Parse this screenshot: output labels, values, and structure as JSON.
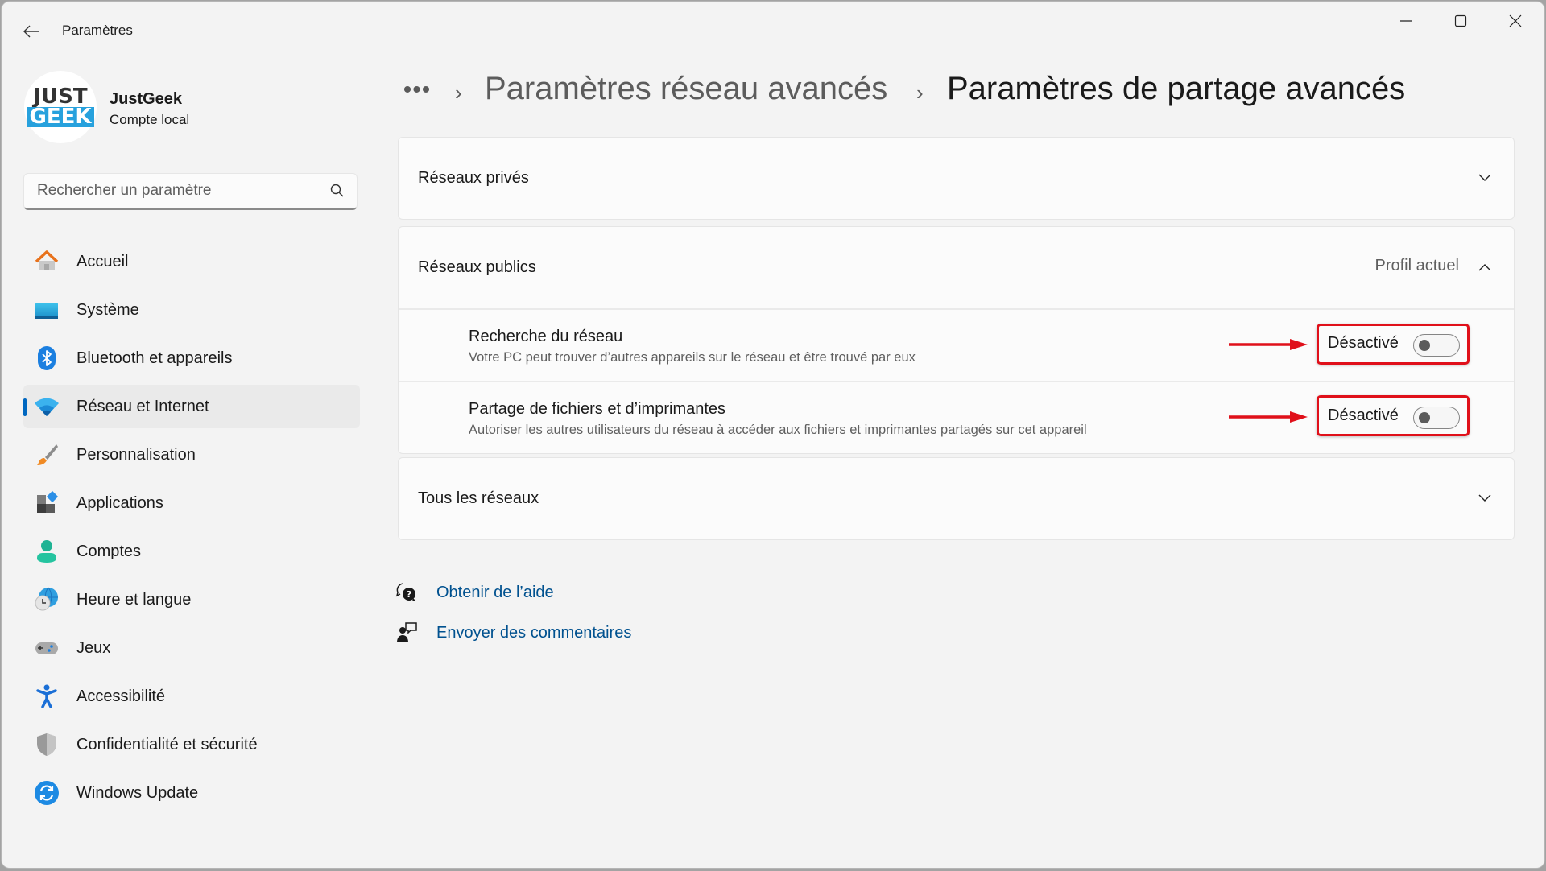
{
  "window": {
    "title": "Paramètres",
    "controls": {
      "minimize": "minimize-icon",
      "maximize": "maximize-icon",
      "close": "close-icon"
    },
    "back_icon": "arrow-left-icon"
  },
  "profile": {
    "avatar_line1": "JUST",
    "avatar_line2": "GEEK",
    "name": "JustGeek",
    "account_type": "Compte local"
  },
  "search": {
    "placeholder": "Rechercher un paramètre",
    "value": "",
    "icon": "search-icon"
  },
  "sidebar": {
    "accent_color": "#0067c0",
    "items": [
      {
        "label": "Accueil",
        "icon": "home-icon",
        "active": false
      },
      {
        "label": "Système",
        "icon": "system-display-icon",
        "active": false
      },
      {
        "label": "Bluetooth et appareils",
        "icon": "bluetooth-icon",
        "active": false
      },
      {
        "label": "Réseau et Internet",
        "icon": "wifi-icon",
        "active": true
      },
      {
        "label": "Personnalisation",
        "icon": "paintbrush-icon",
        "active": false
      },
      {
        "label": "Applications",
        "icon": "apps-icon",
        "active": false
      },
      {
        "label": "Comptes",
        "icon": "account-icon",
        "active": false
      },
      {
        "label": "Heure et langue",
        "icon": "time-language-icon",
        "active": false
      },
      {
        "label": "Jeux",
        "icon": "gamepad-icon",
        "active": false
      },
      {
        "label": "Accessibilité",
        "icon": "accessibility-icon",
        "active": false
      },
      {
        "label": "Confidentialité et sécurité",
        "icon": "shield-icon",
        "active": false
      },
      {
        "label": "Windows Update",
        "icon": "windows-update-icon",
        "active": false
      }
    ]
  },
  "breadcrumb": {
    "more": "•••",
    "separator": "›",
    "parent": "Paramètres réseau avancés",
    "current": "Paramètres de partage avancés"
  },
  "sections": [
    {
      "title": "Réseaux privés",
      "expanded": false,
      "chevron": "chevron-down-icon"
    },
    {
      "title": "Réseaux publics",
      "meta": "Profil actuel",
      "expanded": true,
      "chevron": "chevron-up-icon",
      "settings": [
        {
          "title": "Recherche du réseau",
          "description": "Votre PC peut trouver d’autres appareils sur le réseau et être trouvé par eux",
          "state_label": "Désactivé",
          "on": false
        },
        {
          "title": "Partage de fichiers et d’imprimantes",
          "description": "Autoriser les autres utilisateurs du réseau à accéder aux fichiers et imprimantes partagés sur cet appareil",
          "state_label": "Désactivé",
          "on": false
        }
      ]
    },
    {
      "title": "Tous les réseaux",
      "expanded": false,
      "chevron": "chevron-down-icon"
    }
  ],
  "annotations": {
    "highlight_color": "#e0101a",
    "items": [
      "arrow-to-network-discovery-toggle",
      "arrow-to-file-sharing-toggle"
    ]
  },
  "help_links": [
    {
      "label": "Obtenir de l’aide",
      "icon": "help-chat-icon"
    },
    {
      "label": "Envoyer des commentaires",
      "icon": "feedback-icon"
    }
  ],
  "colors": {
    "link": "#00518f",
    "window_bg": "#f3f3f3",
    "card_bg": "#fbfbfb"
  }
}
